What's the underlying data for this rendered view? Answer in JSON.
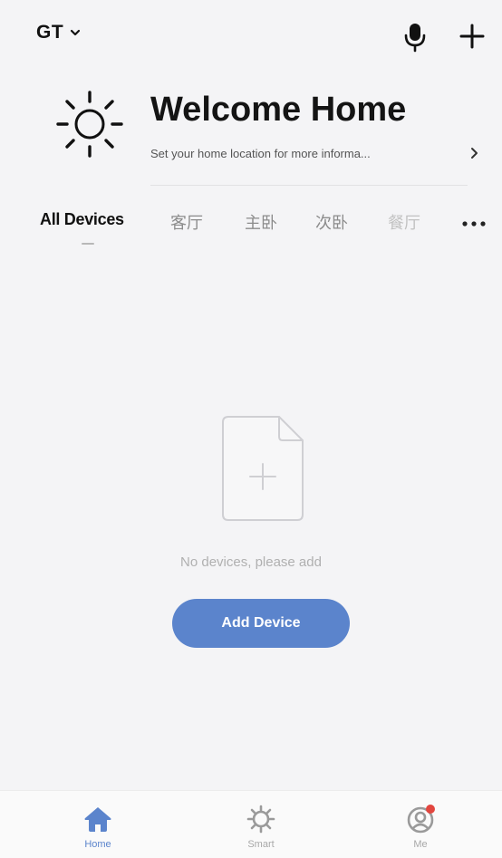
{
  "header": {
    "home_name": "GT"
  },
  "welcome": {
    "title": "Welcome Home",
    "subtitle": "Set your home location for more informa..."
  },
  "tabs": [
    {
      "label": "All Devices",
      "active": true
    },
    {
      "label": "客厅",
      "active": false
    },
    {
      "label": "主卧",
      "active": false
    },
    {
      "label": "次卧",
      "active": false
    },
    {
      "label": "餐厅",
      "active": false
    }
  ],
  "empty_state": {
    "message": "No devices, please add",
    "button_label": "Add Device"
  },
  "bottom_nav": {
    "items": [
      {
        "label": "Home",
        "icon": "home-icon",
        "active": true
      },
      {
        "label": "Smart",
        "icon": "smart-icon",
        "active": false
      },
      {
        "label": "Me",
        "icon": "profile-icon",
        "active": false,
        "badge": true
      }
    ]
  },
  "colors": {
    "accent": "#5b84cc",
    "background": "#f4f4f6",
    "badge": "#e2463f"
  },
  "icons": {
    "weather": "sun-icon",
    "voice": "microphone-icon",
    "add": "plus-icon",
    "more": "more-dots-icon",
    "empty": "add-document-icon"
  }
}
